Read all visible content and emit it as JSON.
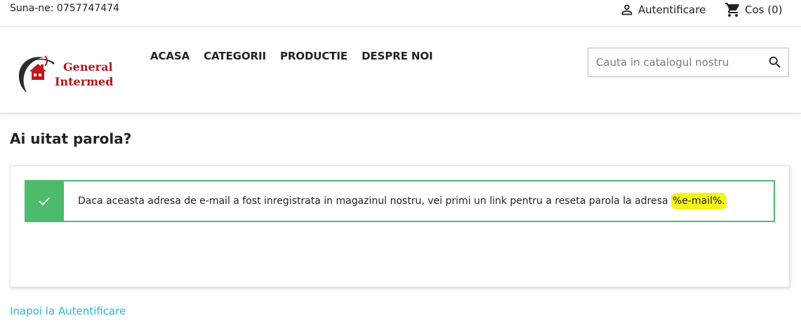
{
  "topbar": {
    "phone": "Suna-ne: 0757747474",
    "login_label": "Autentificare",
    "cart_label": "Cos (0)"
  },
  "header": {
    "logo": {
      "line1": "General",
      "line2": "Intermed"
    },
    "nav": [
      "ACASA",
      "CATEGORII",
      "PRODUCTIE",
      "DESPRE NOI"
    ],
    "search": {
      "placeholder": "Cauta in catalogul nostru",
      "value": ""
    }
  },
  "main": {
    "title": "Ai uitat parola?",
    "alert": {
      "text": "Daca aceasta adresa de e-mail a fost inregistrata in magazinul nostru, vei primi un link pentru a reseta parola la adresa ",
      "highlighted": "%e-mail%."
    },
    "back_link": "Inapoi la Autentificare"
  },
  "colors": {
    "success": "#4cbb6c",
    "link": "#24b9d7",
    "brand_red": "#b5141b",
    "highlight": "#f5f51a"
  },
  "icons": {
    "login": "person-icon",
    "cart": "shopping-cart-icon",
    "search": "search-icon",
    "alert": "check-icon"
  }
}
